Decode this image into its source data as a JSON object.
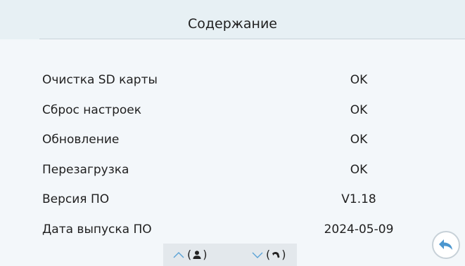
{
  "header": {
    "title": "Содержание"
  },
  "rows": [
    {
      "label": "Очистка SD карты",
      "value": "OK"
    },
    {
      "label": "Сброс настроек",
      "value": "OK"
    },
    {
      "label": "Обновление",
      "value": "OK"
    },
    {
      "label": "Перезагрузка",
      "value": "OK"
    },
    {
      "label": "Версия ПО",
      "value": "V1.18"
    },
    {
      "label": "Дата выпуска ПО",
      "value": "2024-05-09"
    }
  ],
  "footer": {
    "up_icon": "chevron-up-icon",
    "up_hint_icon": "person-icon",
    "down_icon": "chevron-down-icon",
    "down_hint_icon": "handset-icon",
    "open_paren": "(",
    "close_paren": ")",
    "accent_color": "#5aa3d6"
  },
  "back": {
    "icon": "back-arrow-icon",
    "color": "#4b96cf"
  }
}
